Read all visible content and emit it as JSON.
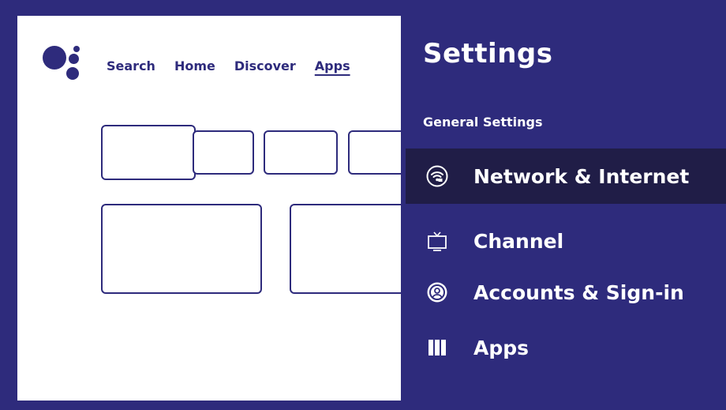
{
  "theme": {
    "accent": "#2e2b7c",
    "selected_bg": "#201d47",
    "home_bg": "#ffffff"
  },
  "home": {
    "logo_icon": "google-assistant-icon",
    "nav": [
      {
        "label": "Search",
        "active": false
      },
      {
        "label": "Home",
        "active": false
      },
      {
        "label": "Discover",
        "active": false
      },
      {
        "label": "Apps",
        "active": true
      }
    ]
  },
  "settings": {
    "title": "Settings",
    "section": "General Settings",
    "items": [
      {
        "label": "Network & Internet",
        "icon": "wifi-icon",
        "selected": true
      },
      {
        "label": "Channel",
        "icon": "tv-icon",
        "selected": false
      },
      {
        "label": "Accounts & Sign-in",
        "icon": "account-icon",
        "selected": false
      },
      {
        "label": "Apps",
        "icon": "apps-icon",
        "selected": false
      }
    ]
  }
}
